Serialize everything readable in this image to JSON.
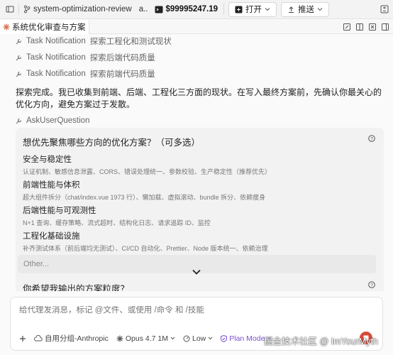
{
  "topbar": {
    "branch": "system-optimization-review",
    "overflow": "a..",
    "cost": "$99995247.19",
    "open_label": "打开",
    "push_label": "推送"
  },
  "tab": {
    "title": "系统优化审查与方案"
  },
  "tool_calls": [
    {
      "name": "Task Notification",
      "desc": "探索工程化和测试现状"
    },
    {
      "name": "Task Notification",
      "desc": "探索后端代码质量"
    },
    {
      "name": "Task Notification",
      "desc": "探索前端代码质量"
    }
  ],
  "message": "探索完成。我已收集到前端、后端、工程化三方面的现状。在写入最终方案前，先确认你最关心的优化方向，避免方案过于发散。",
  "ask_tool": "AskUserQuestion",
  "question": {
    "title": "想优先聚焦哪些方向的优化方案？（可多选）",
    "options": [
      {
        "title": "安全与稳定性",
        "desc": "认证机制、敏感信息泄露、CORS、错误处理统一、参数校验、生产稳定性（推荐优先）"
      },
      {
        "title": "前端性能与体积",
        "desc": "超大组件拆分（chat/index.vue 1973 行）、懒加载、虚拟滚动、bundle 拆分、依赖瘦身"
      },
      {
        "title": "后端性能与可观测性",
        "desc": "N+1 查询、缓存策略、流式超时、结构化日志、请求追踪 ID、监控"
      },
      {
        "title": "工程化基础设施",
        "desc": "补齐测试体系（前后端均无测试）、CI/CD 自动化、Prettier、Node 版本统一、依赖治理"
      }
    ],
    "other_placeholder": "Other...",
    "next_title": "你希望我输出的方案粒度？"
  },
  "composer": {
    "placeholder": "给代理发消息，标记 @文件、或使用 /命令 和 /技能",
    "group": "自用分组-Anthropic",
    "model": "Opus 4.7 1M",
    "effort": "Low",
    "mode": "Plan Mode"
  },
  "watermark": "掘金技术社区 @ ImYourMyth",
  "colors": {
    "accent_send": "#d84b3a",
    "plan_mode": "#7a4fd0"
  }
}
